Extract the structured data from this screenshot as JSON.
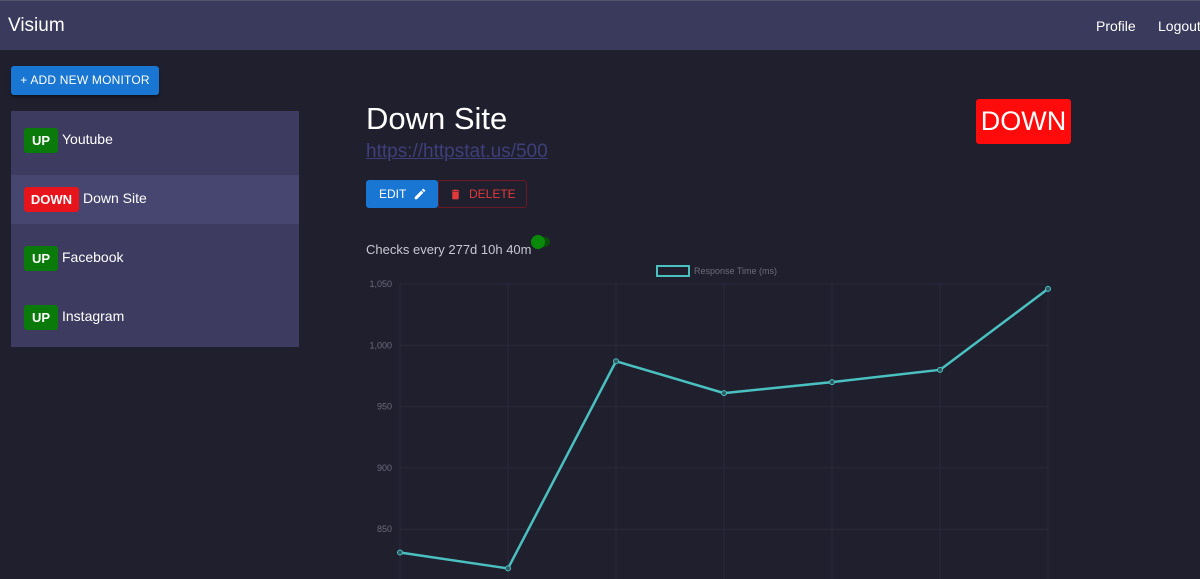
{
  "header": {
    "brand": "Visium",
    "nav": {
      "profile": "Profile",
      "logout": "Logout"
    }
  },
  "sidebar": {
    "add_button": "+ ADD NEW MONITOR",
    "monitors": [
      {
        "status": "UP",
        "name": "Youtube"
      },
      {
        "status": "DOWN",
        "name": "Down Site",
        "selected": true
      },
      {
        "status": "UP",
        "name": "Facebook"
      },
      {
        "status": "UP",
        "name": "Instagram"
      }
    ]
  },
  "detail": {
    "title": "Down Site",
    "url": "https://httpstat.us/500",
    "status": "DOWN",
    "edit_label": "EDIT",
    "delete_label": "DELETE",
    "checks_text": "Checks every 277d 10h 40m",
    "toggle_on": true,
    "icons": {
      "edit": "pencil-icon",
      "delete": "trash-icon"
    }
  },
  "colors": {
    "up": "#0a7a0a",
    "down": "#e8141c",
    "accent": "#1976d2",
    "line": "#4bc0c0"
  },
  "chart_data": {
    "type": "line",
    "series": [
      {
        "name": "Response Time (ms)",
        "values": [
          831,
          818,
          987,
          961,
          970,
          980,
          1046
        ]
      }
    ],
    "y_ticks": [
      "1,050",
      "1,000",
      "950",
      "900",
      "850"
    ],
    "ylim": [
      810,
      1050
    ],
    "grid": true,
    "legend": "top"
  }
}
